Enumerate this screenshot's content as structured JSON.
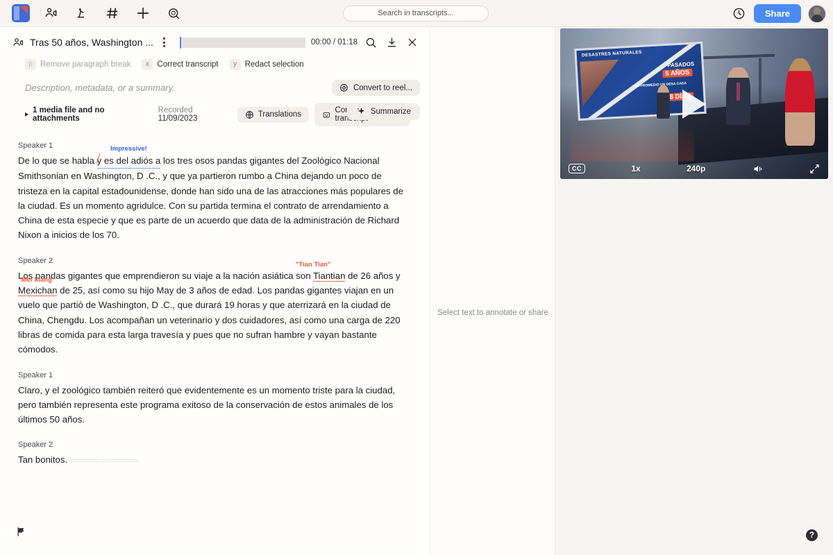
{
  "topbar": {
    "icons": [
      {
        "name": "app-logo",
        "label": "Descript"
      },
      {
        "name": "video-people-icon",
        "label": "Rooms"
      },
      {
        "name": "pen-tool-icon",
        "label": "Draw"
      },
      {
        "name": "hash-icon",
        "label": "Channels"
      },
      {
        "name": "plus-icon",
        "label": "New"
      },
      {
        "name": "globe-search-icon",
        "label": "Explore"
      }
    ],
    "search_placeholder": "Search in transcripts...",
    "history_icon": "clock-icon",
    "share_label": "Share"
  },
  "document": {
    "title": "Tras 50 años, Washington ...",
    "timecode": "00:00 / 01:18",
    "progress_percent": 0,
    "description_placeholder": "Description, metadata, or a summary.",
    "media_summary": "1 media file and no attachments",
    "recorded_label": "Recorded",
    "recorded_date": "11/09/2023",
    "shortcuts": [
      {
        "key": "p",
        "label": "Remove paragraph break",
        "dim": true
      },
      {
        "key": "x",
        "label": "Correct transcript",
        "dim": false
      },
      {
        "key": "y",
        "label": "Redact selection",
        "dim": false
      }
    ],
    "convert_label": "Convert to reel...",
    "summarize_label": "Summarize",
    "translations_label": "Translations",
    "computer_transcript_label": "Computer transcript"
  },
  "transcript": {
    "blocks": [
      {
        "speaker": "Speaker 1",
        "text_before": "De lo que se habla ",
        "marked": "y es del adiós a",
        "mark_color": "blue",
        "text_after": " los tres osos pandas gigantes del Zoológico Nacional Smithsonian en Washington, D .C., y que ya partieron rumbo a China dejando un poco de tristeza en la capital estadounidense, donde han sido una de las atracciones más populares de la ciudad. Es un momento agridulce. Con su partida termina el contrato de arrendamiento a China de esta especie y que es parte de un acuerdo que data de la administración de Richard Nixon a inicios de los 70.",
        "note": "Impressive!"
      },
      {
        "speaker": "Speaker 2",
        "text_before": "Los pandas gigantes que emprendieron su viaje a la nación asiática son ",
        "marked": "Tiantian",
        "mark_color": "red",
        "text_mid": " de 26 años y ",
        "marked2": "Mexichan",
        "text_after": " de 25, así como su hijo May de 3 años de edad. Los pandas gigantes viajan en un vuelo que partió de Washington, D .C., que durará 19 horas y que aterrizará en la ciudad de China, Chengdu. Los acompañan un veterinario y dos cuidadores, así como una carga de 220 libras de comida para esta larga travesía y pues que no sufran hambre y vayan bastante cómodos.",
        "note": "\"Tian Tian\"",
        "note2": "\"Mei Xiang\""
      },
      {
        "speaker": "Speaker 1",
        "text_before": "Claro, y el zoológico también reiteró que evidentemente es un momento triste para la ciudad, pero también representa este programa exitoso de la conservación de estos animales de los últimos 50 años.",
        "marked": "",
        "text_after": ""
      },
      {
        "speaker": "Speaker 2",
        "text_before": "Tan bonitos.",
        "marked": "",
        "text_after": "",
        "ghost": "▭▭▭▭▭▭▭▭▭"
      }
    ]
  },
  "annotations_panel": {
    "hint": "Select text to annotate or share"
  },
  "video": {
    "graphic": {
      "title": "DESASTRES NATURALES",
      "line1": "PASADOS",
      "line2": "5 AÑOS",
      "line3": "EN PROMEDIO UN DESA CADA",
      "line4": "18 DÍAS"
    },
    "controls": {
      "cc_label": "CC",
      "speed": "1x",
      "quality": "240p",
      "volume_icon": "volume-icon",
      "fullscreen_icon": "fullscreen-icon",
      "play_icon": "play-icon"
    }
  },
  "footer": {
    "flag_icon": "flag-icon",
    "help_label": "?"
  },
  "colors": {
    "accent_blue": "#4a8af4",
    "annotation_blue": "#3562d6",
    "annotation_red": "#ef5738",
    "bg": "#f7f5f2"
  }
}
